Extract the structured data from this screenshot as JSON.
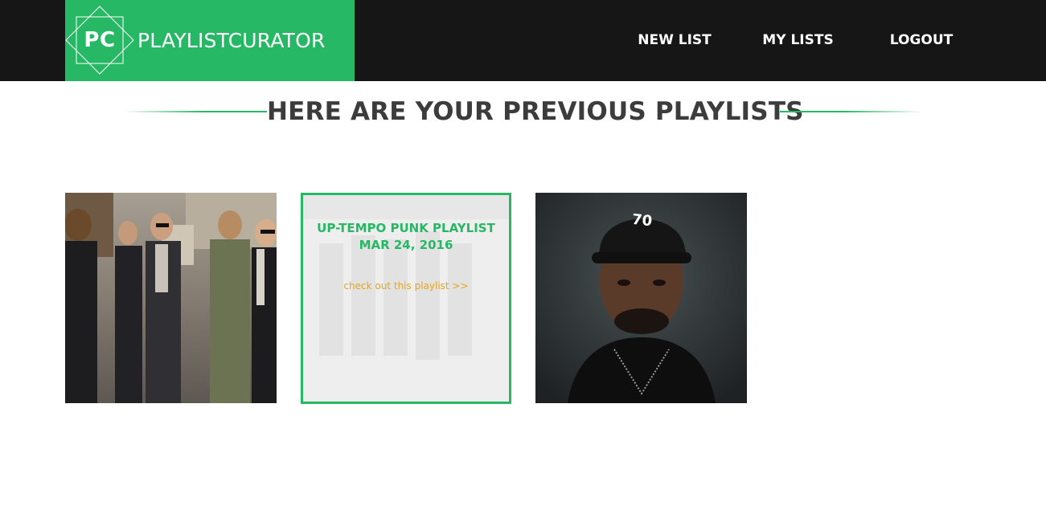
{
  "header": {
    "logo_initials": "PC",
    "brand_name": "PLAYLISTCURATOR",
    "nav": {
      "new_list": "NEW LIST",
      "my_lists": "MY LISTS",
      "logout": "LOGOUT"
    }
  },
  "main": {
    "heading": "HERE ARE YOUR PREVIOUS PLAYLISTS",
    "playlists": [
      {
        "image": "band-photo-street"
      },
      {
        "title": "UP-TEMPO PUNK PLAYLIST",
        "date": "MAR 24, 2016",
        "link_text": "check out this playlist >>",
        "image": "punk-band-photo"
      },
      {
        "image": "portrait-black-cap-photo"
      }
    ]
  },
  "colors": {
    "brand_green": "#27b865",
    "topbar": "#161616",
    "link_orange": "#e6a51e",
    "heading_text": "#3c3c3c"
  }
}
